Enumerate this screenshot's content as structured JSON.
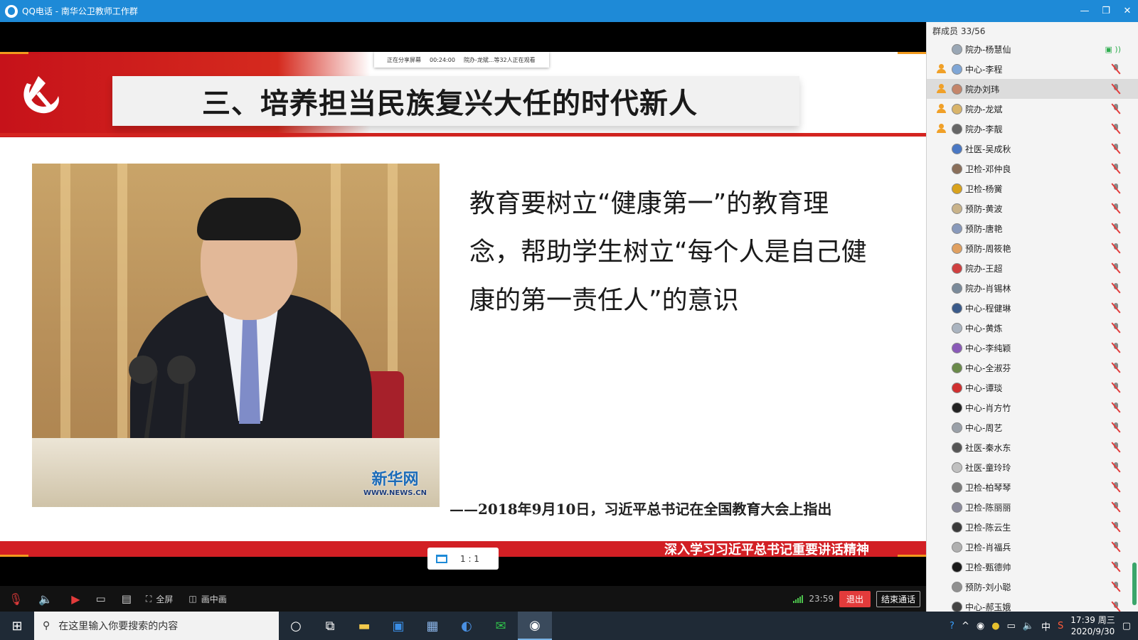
{
  "titlebar": {
    "title": "QQ电话 - 南华公卫教师工作群",
    "minimize": "—",
    "restore": "❐",
    "close": "✕"
  },
  "slide": {
    "title": "三、培养担当民族复兴大任的时代新人",
    "share_status": "正在分享屏幕",
    "share_duration": "00:24:00",
    "share_viewers": "院办-龙斌...等32人正在观看",
    "quote": "教育要树立“健康第一”的教育理念，帮助学生树立“每个人是自己健康的第一责任人”的意识",
    "citation": "——2018年9月10日，习近平总书记在全国教育大会上指出",
    "watermark_main": "新华网",
    "watermark_sub": "WWW.NEWS.CN",
    "bottom_banner": "深入学习习近平总书记重要讲话精神",
    "ratio_label": "1 : 1"
  },
  "controls": {
    "fullscreen_label": "全屏",
    "pip_label": "画中画",
    "timer": "23:59",
    "exit_label": "退出",
    "end_call_label": "结束通话"
  },
  "members": {
    "header": "群成员 33/56",
    "list": [
      {
        "name": "院办-杨慧仙",
        "manager": false,
        "status": "speaking",
        "avatar_color": "#9aa7b5"
      },
      {
        "name": "中心-李程",
        "manager": true,
        "status": "muted",
        "avatar_color": "#7fa6d6"
      },
      {
        "name": "院办刘玮",
        "manager": true,
        "status": "muted",
        "avatar_color": "#c4856a",
        "selected": true
      },
      {
        "name": "院办-龙斌",
        "manager": true,
        "status": "muted",
        "avatar_color": "#d9b46a"
      },
      {
        "name": "院办-李靓",
        "manager": true,
        "status": "muted",
        "avatar_color": "#666666"
      },
      {
        "name": "社医-吴成秋",
        "manager": false,
        "status": "muted",
        "avatar_color": "#4a78c4"
      },
      {
        "name": "卫检-邓仲良",
        "manager": false,
        "status": "muted",
        "avatar_color": "#8a6f5a"
      },
      {
        "name": "卫检-杨黉",
        "manager": false,
        "status": "muted",
        "avatar_color": "#d9a21c"
      },
      {
        "name": "预防-黄波",
        "manager": false,
        "status": "muted",
        "avatar_color": "#c9b38a"
      },
      {
        "name": "预防-唐艳",
        "manager": false,
        "status": "muted",
        "avatar_color": "#8899bb"
      },
      {
        "name": "预防-周筱艳",
        "manager": false,
        "status": "muted",
        "avatar_color": "#e0a060"
      },
      {
        "name": "院办-王超",
        "manager": false,
        "status": "muted",
        "avatar_color": "#d04040"
      },
      {
        "name": "院办-肖锡林",
        "manager": false,
        "status": "muted",
        "avatar_color": "#7a8a9a"
      },
      {
        "name": "中心-程健琳",
        "manager": false,
        "status": "muted",
        "avatar_color": "#3a5a8a"
      },
      {
        "name": "中心-黄炼",
        "manager": false,
        "status": "muted",
        "avatar_color": "#aab4c0"
      },
      {
        "name": "中心-李纯颖",
        "manager": false,
        "status": "muted",
        "avatar_color": "#8a5ab8"
      },
      {
        "name": "中心-全淑芬",
        "manager": false,
        "status": "muted",
        "avatar_color": "#6a8a4a"
      },
      {
        "name": "中心-谭琰",
        "manager": false,
        "status": "muted",
        "avatar_color": "#d03030"
      },
      {
        "name": "中心-肖方竹",
        "manager": false,
        "status": "muted",
        "avatar_color": "#222222"
      },
      {
        "name": "中心-周艺",
        "manager": false,
        "status": "muted",
        "avatar_color": "#9aa0a8"
      },
      {
        "name": "社医-秦水东",
        "manager": false,
        "status": "muted",
        "avatar_color": "#555555"
      },
      {
        "name": "社医-童玲玲",
        "manager": false,
        "status": "muted",
        "avatar_color": "#c0c0c0"
      },
      {
        "name": "卫检-柏琴琴",
        "manager": false,
        "status": "muted",
        "avatar_color": "#7a7a7a"
      },
      {
        "name": "卫检-陈丽丽",
        "manager": false,
        "status": "muted",
        "avatar_color": "#8a8a9a"
      },
      {
        "name": "卫检-陈云生",
        "manager": false,
        "status": "muted",
        "avatar_color": "#3a3a3a"
      },
      {
        "name": "卫检-肖福兵",
        "manager": false,
        "status": "muted",
        "avatar_color": "#b0b0b0"
      },
      {
        "name": "卫检-甄德帅",
        "manager": false,
        "status": "muted",
        "avatar_color": "#1a1a1a"
      },
      {
        "name": "预防-刘小聪",
        "manager": false,
        "status": "muted",
        "avatar_color": "#909090"
      },
      {
        "name": "中心-郝玉娥",
        "manager": false,
        "status": "muted",
        "avatar_color": "#444444"
      }
    ]
  },
  "taskbar": {
    "search_placeholder": "在这里输入你要搜索的内容",
    "ime": "中",
    "time": "17:39 周三",
    "date": "2020/9/30"
  },
  "colors": {
    "titlebar": "#1e8ad7",
    "slide_red": "#d42420",
    "exit_red": "#e23b3b",
    "speaking_green": "#2fae4f"
  }
}
